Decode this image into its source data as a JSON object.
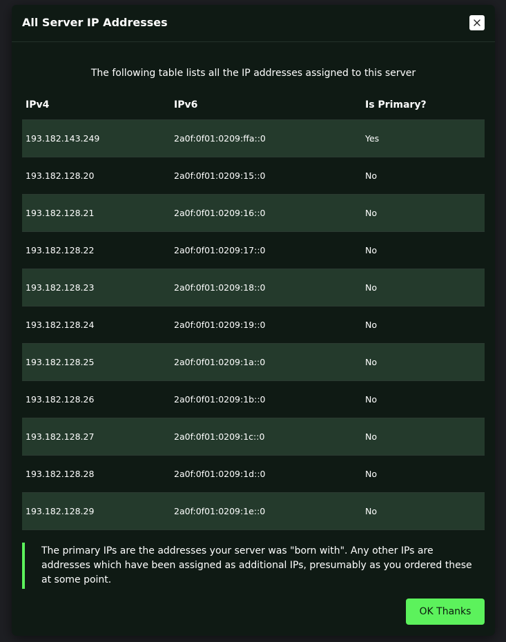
{
  "modal": {
    "title": "All Server IP Addresses",
    "intro": "The following table lists all the IP addresses assigned to this server",
    "close_icon": "close-icon",
    "columns": {
      "ipv4": "IPv4",
      "ipv6": "IPv6",
      "primary": "Is Primary?"
    },
    "rows": [
      {
        "ipv4": "193.182.143.249",
        "ipv6": "2a0f:0f01:0209:ffa::0",
        "primary": "Yes"
      },
      {
        "ipv4": "193.182.128.20",
        "ipv6": "2a0f:0f01:0209:15::0",
        "primary": "No"
      },
      {
        "ipv4": "193.182.128.21",
        "ipv6": "2a0f:0f01:0209:16::0",
        "primary": "No"
      },
      {
        "ipv4": "193.182.128.22",
        "ipv6": "2a0f:0f01:0209:17::0",
        "primary": "No"
      },
      {
        "ipv4": "193.182.128.23",
        "ipv6": "2a0f:0f01:0209:18::0",
        "primary": "No"
      },
      {
        "ipv4": "193.182.128.24",
        "ipv6": "2a0f:0f01:0209:19::0",
        "primary": "No"
      },
      {
        "ipv4": "193.182.128.25",
        "ipv6": "2a0f:0f01:0209:1a::0",
        "primary": "No"
      },
      {
        "ipv4": "193.182.128.26",
        "ipv6": "2a0f:0f01:0209:1b::0",
        "primary": "No"
      },
      {
        "ipv4": "193.182.128.27",
        "ipv6": "2a0f:0f01:0209:1c::0",
        "primary": "No"
      },
      {
        "ipv4": "193.182.128.28",
        "ipv6": "2a0f:0f01:0209:1d::0",
        "primary": "No"
      },
      {
        "ipv4": "193.182.128.29",
        "ipv6": "2a0f:0f01:0209:1e::0",
        "primary": "No"
      }
    ],
    "note": "The primary IPs are the addresses your server was \"born with\". Any other IPs are addresses which have been assigned as additional IPs, presumably as you ordered these at some point.",
    "ok_label": "OK Thanks"
  },
  "colors": {
    "modal_bg": "#0f1a14",
    "row_stripe": "#243a2c",
    "accent": "#5cf25c",
    "backdrop": "#2a2c30"
  }
}
